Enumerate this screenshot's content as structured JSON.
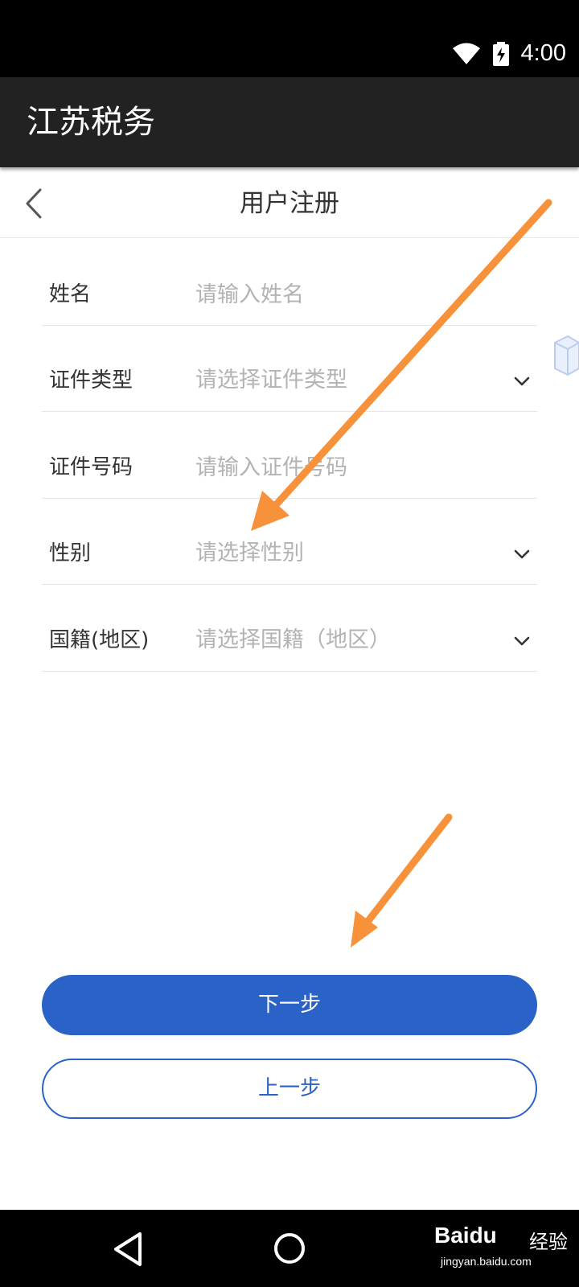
{
  "status_bar": {
    "time": "4:00",
    "icons": [
      "wifi-icon",
      "battery-charging-icon"
    ]
  },
  "app_bar": {
    "title": "江苏税务"
  },
  "page": {
    "title": "用户注册",
    "back_icon": "chevron-left-icon"
  },
  "form": {
    "fields": [
      {
        "label": "姓名",
        "placeholder": "请输入姓名",
        "type": "text"
      },
      {
        "label": "证件类型",
        "placeholder": "请选择证件类型",
        "type": "select"
      },
      {
        "label": "证件号码",
        "placeholder": "请输入证件号码",
        "type": "text"
      },
      {
        "label": "性别",
        "placeholder": "请选择性别",
        "type": "select"
      },
      {
        "label": "国籍(地区)",
        "placeholder": "请选择国籍（地区）",
        "type": "select"
      }
    ]
  },
  "buttons": {
    "next": "下一步",
    "previous": "上一步"
  },
  "nav_bar": {
    "icons": [
      "nav-back-icon",
      "nav-home-icon"
    ]
  },
  "watermark": {
    "brand": "Baidu",
    "product": "经验",
    "url": "jingyan.baidu.com"
  },
  "colors": {
    "primary": "#2a62c8",
    "annotation_arrow": "#f7923a",
    "app_bar": "#222222"
  }
}
